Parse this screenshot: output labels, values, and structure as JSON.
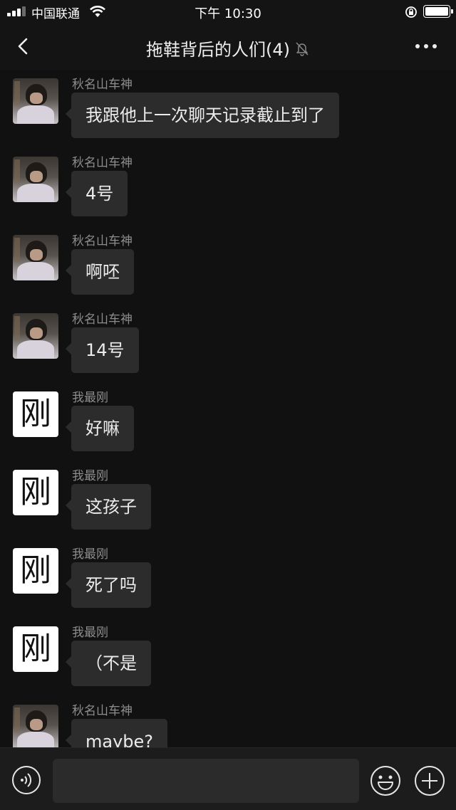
{
  "status_bar": {
    "carrier": "中国联通",
    "time": "下午 10:30",
    "icons": [
      "signal-icon",
      "wifi-icon",
      "rotation-lock-icon",
      "battery-icon"
    ]
  },
  "header": {
    "title": "拖鞋背后的人们(4)",
    "icons": [
      "back-chevron-icon",
      "mute-bell-icon",
      "more-dots-icon"
    ]
  },
  "messages": [
    {
      "sender": "秋名山车神",
      "avatar": "photo",
      "text": "我跟他上一次聊天记录截止到了"
    },
    {
      "sender": "秋名山车神",
      "avatar": "photo",
      "text": "4号"
    },
    {
      "sender": "秋名山车神",
      "avatar": "photo",
      "text": "啊呸"
    },
    {
      "sender": "秋名山车神",
      "avatar": "photo",
      "text": "14号"
    },
    {
      "sender": "我最刚",
      "avatar": "glyph",
      "avatar_text": "刚",
      "text": "好嘛"
    },
    {
      "sender": "我最刚",
      "avatar": "glyph",
      "avatar_text": "刚",
      "text": "这孩子"
    },
    {
      "sender": "我最刚",
      "avatar": "glyph",
      "avatar_text": "刚",
      "text": "死了吗"
    },
    {
      "sender": "我最刚",
      "avatar": "glyph",
      "avatar_text": "刚",
      "text": "（不是"
    },
    {
      "sender": "秋名山车神",
      "avatar": "photo",
      "text": "maybe?"
    }
  ],
  "input_bar": {
    "placeholder": "",
    "icons": [
      "voice-icon",
      "emoji-icon",
      "plus-icon"
    ]
  },
  "colors": {
    "background": "#111111",
    "bubble": "#2c2c2c",
    "sender_text": "#8d8d8d"
  }
}
